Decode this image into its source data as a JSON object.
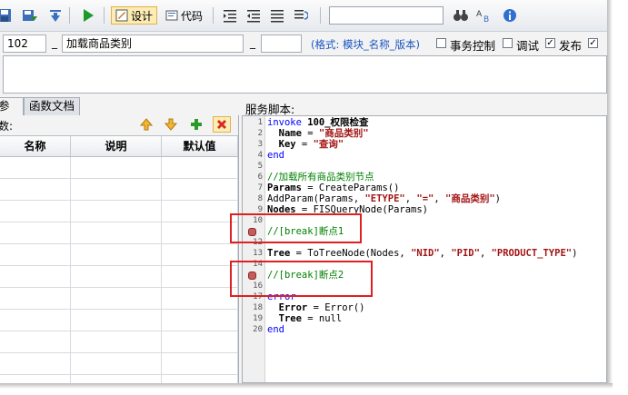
{
  "toolbar": {
    "design_label": "设计",
    "code_label": "代码",
    "search_value": ""
  },
  "header": {
    "module_id": "102",
    "service_name": "加载商品类别",
    "version_value": "",
    "format_hint": "(格式: 模块_名称_版本)",
    "transaction_label": "事务控制",
    "debug_label": "调试",
    "publish_label": "发布",
    "transaction_checked": false,
    "debug_checked": false,
    "publish_checked": true
  },
  "tabs": [
    {
      "label": "参数"
    },
    {
      "label": "函数文档"
    }
  ],
  "params": {
    "toolbar_label": "数:",
    "columns": [
      "名称",
      "说明",
      "默认值"
    ],
    "rows": 11
  },
  "script": {
    "label": "服务脚本:",
    "lines": [
      {
        "n": "1"
      },
      {
        "n": "2"
      },
      {
        "n": "3"
      },
      {
        "n": "4"
      },
      {
        "n": "5"
      },
      {
        "n": "6"
      },
      {
        "n": "7"
      },
      {
        "n": "8"
      },
      {
        "n": "9"
      },
      {
        "n": "10"
      },
      {
        "n": "11"
      },
      {
        "n": "12"
      },
      {
        "n": "13"
      },
      {
        "n": "14"
      },
      {
        "n": "15"
      },
      {
        "n": "16"
      },
      {
        "n": "17"
      },
      {
        "n": "18"
      },
      {
        "n": "19"
      },
      {
        "n": "20"
      }
    ],
    "breakpoint_lines": [
      11,
      15
    ],
    "t_invoke": "invoke",
    "t_invoke_name": " 100_权限检查",
    "t_name_key": "  Name",
    "t_eq": " = ",
    "t_name_val": "\"商品类别\"",
    "t_key_key": "  Key",
    "t_key_val": "\"查询\"",
    "t_end": "end",
    "t_comment_load": "//加载所有商品类别节点",
    "t_params_var": "Params",
    "t_params_call": " = CreateParams()",
    "t_addparam": "AddParam(Params, ",
    "t_etype": "\"ETYPE\"",
    "t_comma": ", ",
    "t_eqstr": "\"=\"",
    "t_cat": "\"商品类别\"",
    "t_close": ")",
    "t_nodes_var": "Nodes",
    "t_nodes_call": " = FISQueryNode(Params)",
    "t_break1": "//[break]断点1",
    "t_tree_var": "Tree",
    "t_tree_call": " = ToTreeNode(Nodes, ",
    "t_nid": "\"NID\"",
    "t_pid": "\"PID\"",
    "t_ptype": "\"PRODUCT_TYPE\"",
    "t_break2": "//[break]断点2",
    "t_error": "error",
    "t_error_var": "  Error",
    "t_error_call": " = Error()",
    "t_tree2_var": "  Tree",
    "t_tree2_call": " = null",
    "t_end2": "end"
  },
  "colors": {
    "keyword": "#0000ff",
    "string": "#a31515",
    "comment": "#008000",
    "highlight_box": "#e02020"
  }
}
